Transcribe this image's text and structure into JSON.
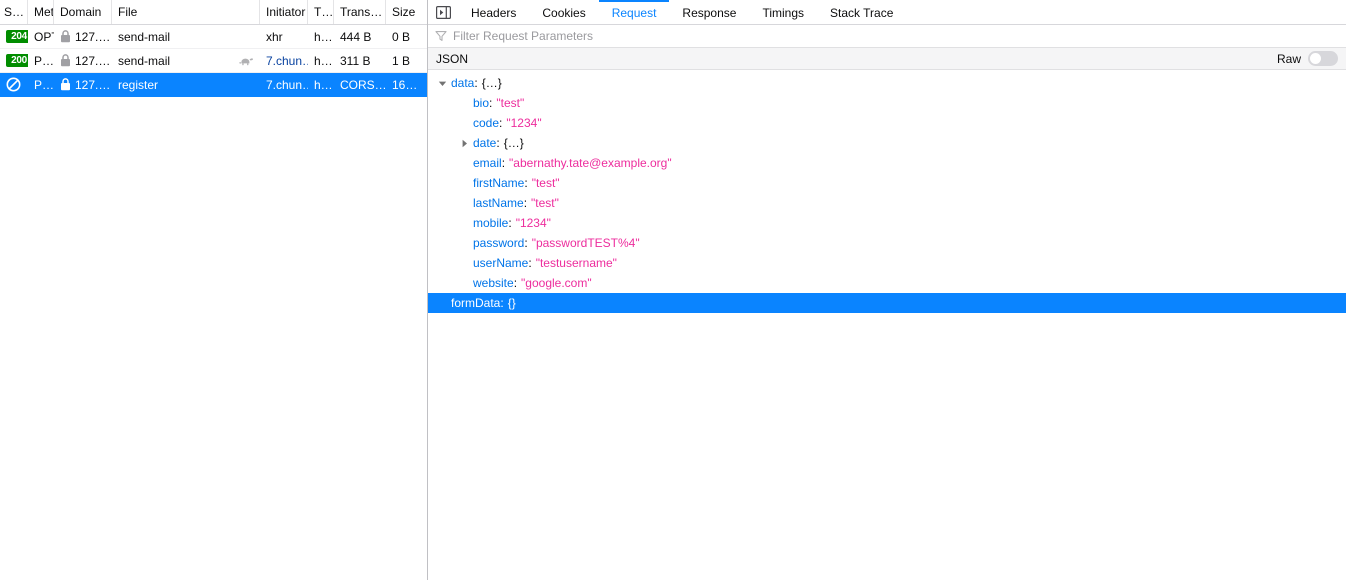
{
  "network_list": {
    "columns": [
      {
        "key": "status",
        "label": "S…"
      },
      {
        "key": "method",
        "label": "Met"
      },
      {
        "key": "domain",
        "label": "Domain"
      },
      {
        "key": "file",
        "label": "File"
      },
      {
        "key": "initiator",
        "label": "Initiator"
      },
      {
        "key": "type",
        "label": "T…"
      },
      {
        "key": "transferred",
        "label": "Trans…"
      },
      {
        "key": "size",
        "label": "Size"
      }
    ],
    "rows": [
      {
        "status": "204",
        "status_kind": "badge",
        "method": "OPTI",
        "domain": "127.…",
        "domain_icon": "lock-icon",
        "file": "send-mail",
        "file_icon": "",
        "initiator": "xhr",
        "initiator_link": false,
        "type": "h…",
        "transferred": "444 B",
        "size": "0 B",
        "selected": false
      },
      {
        "status": "200",
        "status_kind": "badge",
        "method": "P…",
        "domain": "127.…",
        "domain_icon": "lock-icon",
        "file": "send-mail",
        "file_icon": "turtle-icon",
        "initiator": "7.chun…",
        "initiator_link": true,
        "type": "h…",
        "transferred": "311 B",
        "size": "1 B",
        "selected": false
      },
      {
        "status": "",
        "status_kind": "blocked-icon",
        "method": "P…",
        "domain": "127.…",
        "domain_icon": "lock-icon",
        "file": "register",
        "file_icon": "",
        "initiator": "7.chun…",
        "initiator_link": true,
        "type": "h…",
        "transferred": "CORS…",
        "size": "16…",
        "selected": true
      }
    ]
  },
  "details": {
    "panel_toggle_icon": "toggle-sidebar-icon",
    "tabs": [
      {
        "label": "Headers",
        "active": false
      },
      {
        "label": "Cookies",
        "active": false
      },
      {
        "label": "Request",
        "active": true
      },
      {
        "label": "Response",
        "active": false
      },
      {
        "label": "Timings",
        "active": false
      },
      {
        "label": "Stack Trace",
        "active": false
      }
    ],
    "filter": {
      "icon": "funnel-icon",
      "placeholder": "Filter Request Parameters",
      "value": ""
    },
    "section": {
      "title": "JSON",
      "raw_label": "Raw",
      "raw_enabled": false
    },
    "tree": [
      {
        "indent": 0,
        "twisty": "expanded",
        "key": "data",
        "sep": ":",
        "value": "{…}",
        "value_kind": "object",
        "selected": false
      },
      {
        "indent": 1,
        "twisty": "none",
        "key": "bio",
        "sep": ":",
        "value": "\"test\"",
        "value_kind": "string",
        "selected": false
      },
      {
        "indent": 1,
        "twisty": "none",
        "key": "code",
        "sep": ":",
        "value": "\"1234\"",
        "value_kind": "string",
        "selected": false
      },
      {
        "indent": 1,
        "twisty": "collapsed",
        "key": "date",
        "sep": ":",
        "value": "{…}",
        "value_kind": "object",
        "selected": false
      },
      {
        "indent": 1,
        "twisty": "none",
        "key": "email",
        "sep": ":",
        "value": "\"abernathy.tate@example.org\"",
        "value_kind": "string",
        "selected": false
      },
      {
        "indent": 1,
        "twisty": "none",
        "key": "firstName",
        "sep": ":",
        "value": "\"test\"",
        "value_kind": "string",
        "selected": false
      },
      {
        "indent": 1,
        "twisty": "none",
        "key": "lastName",
        "sep": ":",
        "value": "\"test\"",
        "value_kind": "string",
        "selected": false
      },
      {
        "indent": 1,
        "twisty": "none",
        "key": "mobile",
        "sep": ":",
        "value": "\"1234\"",
        "value_kind": "string",
        "selected": false
      },
      {
        "indent": 1,
        "twisty": "none",
        "key": "password",
        "sep": ":",
        "value": "\"passwordTEST%4\"",
        "value_kind": "string",
        "selected": false
      },
      {
        "indent": 1,
        "twisty": "none",
        "key": "userName",
        "sep": ":",
        "value": "\"testusername\"",
        "value_kind": "string",
        "selected": false
      },
      {
        "indent": 1,
        "twisty": "none",
        "key": "website",
        "sep": ":",
        "value": "\"google.com\"",
        "value_kind": "string",
        "selected": false
      },
      {
        "indent": 0,
        "twisty": "none",
        "key": "formData",
        "sep": ":",
        "value": "{}",
        "value_kind": "object",
        "selected": true
      }
    ]
  },
  "colors": {
    "accent": "#0a84ff",
    "status_ok": "#018d00",
    "json_key": "#0074e8",
    "json_string": "#ed2d9d",
    "link": "#0842a0"
  }
}
